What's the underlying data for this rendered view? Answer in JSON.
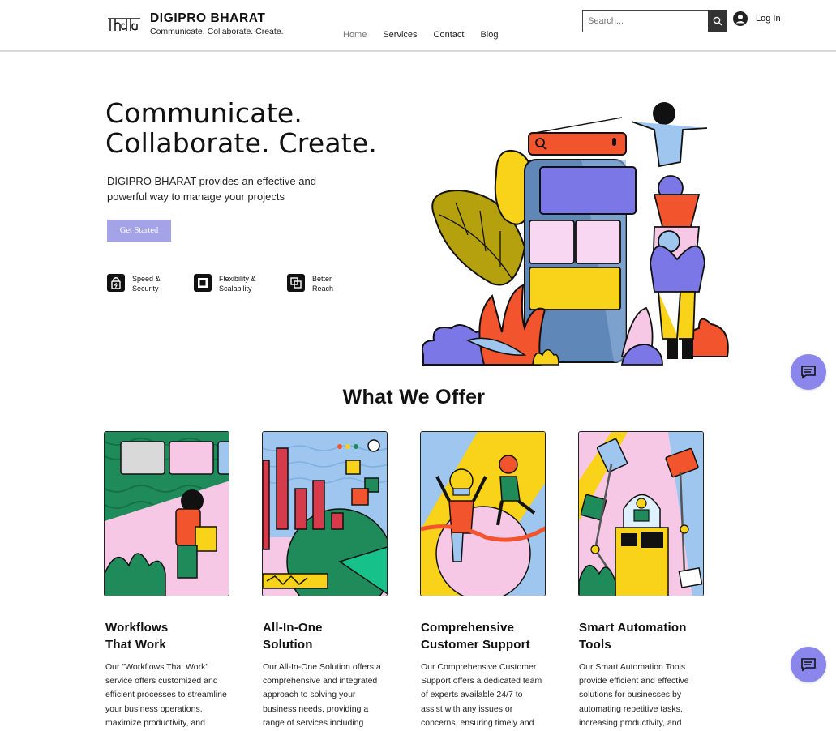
{
  "header": {
    "logo_text": "India",
    "brand": "DIGIPRO BHARAT",
    "tagline": "Communicate. Collaborate. Create.",
    "nav": [
      "Home",
      "Services",
      "Contact",
      "Blog"
    ],
    "active_nav": "Home",
    "search_placeholder": "Search...",
    "login_label": "Log In"
  },
  "hero": {
    "title_line1": "Communicate.",
    "title_line2": "Collaborate. Create.",
    "description": "DIGIPRO BHARAT provides an effective and powerful way to manage your projects",
    "cta_label": "Get Started",
    "features": [
      {
        "line1": "Speed &",
        "line2": "Security",
        "icon": "lock-icon"
      },
      {
        "line1": "Flexibility &",
        "line2": "Scalability",
        "icon": "square-frame-icon"
      },
      {
        "line1": "Better",
        "line2": "Reach",
        "icon": "link-squares-icon"
      }
    ]
  },
  "offer": {
    "title": "What We Offer",
    "cards": [
      {
        "title_line1": "Workflows",
        "title_line2": "That Work",
        "description": "Our \"Workflows That Work\" service offers customized and efficient processes to streamline your business operations, maximize productivity, and"
      },
      {
        "title_line1": "All-In-One",
        "title_line2": "Solution",
        "description": "Our All-In-One Solution offers a comprehensive and integrated approach to solving your business needs, providing a range of services including"
      },
      {
        "title_line1": "Comprehensive",
        "title_line2": "Customer Support",
        "description": "Our Comprehensive Customer Support offers a dedicated team of experts available 24/7 to assist with any issues or concerns, ensuring timely and"
      },
      {
        "title_line1": "Smart Automation",
        "title_line2": "Tools",
        "description": "Our Smart Automation Tools provide efficient and effective solutions for businesses by automating repetitive tasks, increasing productivity, and"
      }
    ]
  },
  "colors": {
    "accent": "#8a86ec",
    "cta": "#a4a3e8",
    "purple": "#7b77e6",
    "yellow": "#f9d21a",
    "orange": "#f2542d",
    "green": "#1f8b5a",
    "pink": "#f6c8e6",
    "blue": "#9ec6ef"
  },
  "chat_icon": "chat-bubble-icon"
}
